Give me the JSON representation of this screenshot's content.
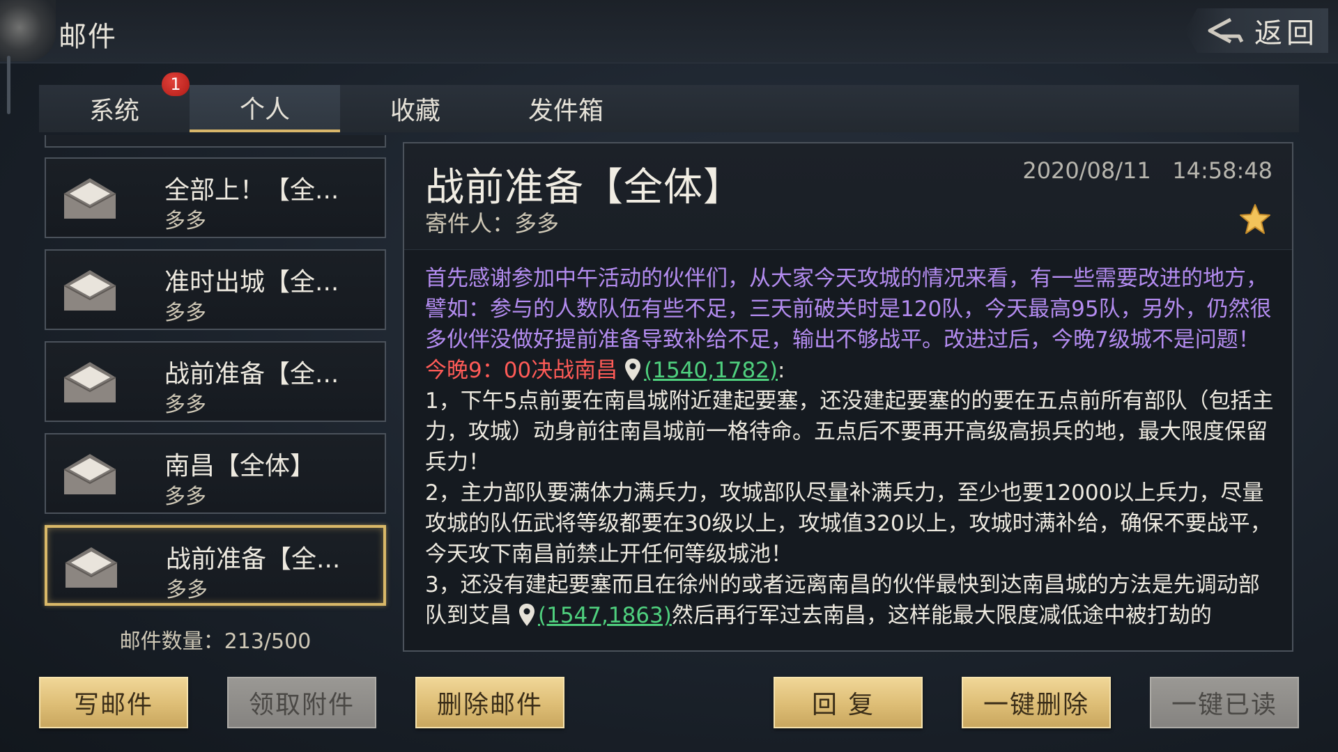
{
  "header": {
    "title": "邮件",
    "back_label": "返回"
  },
  "tabs": [
    {
      "label": "系统",
      "active": false
    },
    {
      "label": "个人",
      "active": true
    },
    {
      "label": "收藏",
      "active": false
    },
    {
      "label": "发件箱",
      "active": false
    }
  ],
  "tab_badge": "1",
  "mail_list": [
    {
      "subject": "全部上！【全...",
      "sender": "多多",
      "selected": false
    },
    {
      "subject": "准时出城【全...",
      "sender": "多多",
      "selected": false
    },
    {
      "subject": "战前准备【全...",
      "sender": "多多",
      "selected": false
    },
    {
      "subject": "南昌【全体】",
      "sender": "多多",
      "selected": false
    },
    {
      "subject": "战前准备【全...",
      "sender": "多多",
      "selected": true
    }
  ],
  "mail_count": "邮件数量：213/500",
  "detail": {
    "title": "战前准备【全体】",
    "date": "2020/08/11",
    "time": "14:58:48",
    "sender_line": "寄件人：多多",
    "intro": "首先感谢参加中午活动的伙伴们，从大家今天攻城的情况来看，有一些需要改进的地方，譬如：参与的人数队伍有些不足，三天前破关时是120队，今天最高95队，另外，仍然很多伙伴没做好提前准备导致补给不足，输出不够战平。改进过后，今晚7级城不是问题！",
    "battle_line": "今晚9：00决战南昌",
    "coord1": "(1540,1782)",
    "colon": ":",
    "point1": "1，下午5点前要在南昌城附近建起要塞，还没建起要塞的的要在五点前所有部队（包括主力，攻城）动身前往南昌城前一格待命。五点后不要再开高级高损兵的地，最大限度保留兵力！",
    "point2": "2，主力部队要满体力满兵力，攻城部队尽量补满兵力，至少也要12000以上兵力，尽量攻城的队伍武将等级都要在30级以上，攻城值320以上，攻城时满补给，确保不要战平，今天攻下南昌前禁止开任何等级城池！",
    "point3": "3，还没有建起要塞而且在徐州的或者远离南昌的伙伴最快到达南昌城的方法是先调动部队到艾昌",
    "coord2": "(1547,1863)",
    "point3_tail": "然后再行军过去南昌，这样能最大限度减低途中被打劫的"
  },
  "buttons": {
    "write": "写邮件",
    "collect": "领取附件",
    "delete": "删除邮件",
    "reply": "回复",
    "delete_all": "一键删除",
    "read_all": "一键已读"
  },
  "colors": {
    "accent_gold": "#d9b868",
    "body_purple": "#b48cf0",
    "highlight_red": "#ff5b57",
    "link_green": "#4fd07e"
  }
}
